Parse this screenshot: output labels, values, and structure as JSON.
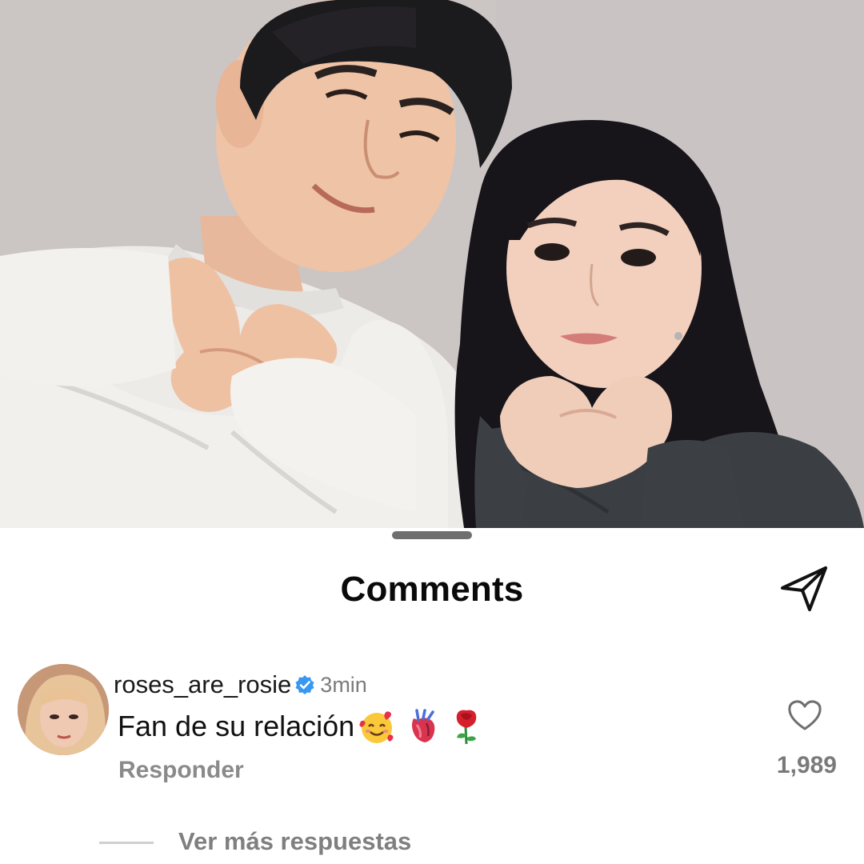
{
  "post": {
    "photo_icon": "couple-photo"
  },
  "comments_sheet": {
    "title": "Comments",
    "share_icon": "paper-plane-icon"
  },
  "comment": {
    "username": "roses_are_rosie",
    "verified": true,
    "verified_color": "#3897f0",
    "timestamp": "3min",
    "text": "Fan de su relación",
    "emojis": [
      "smiling-face-with-hearts",
      "anatomical-heart",
      "rose"
    ],
    "reply_label": "Responder",
    "like_count": "1,989",
    "view_more_replies_label": "Ver más respuestas"
  }
}
